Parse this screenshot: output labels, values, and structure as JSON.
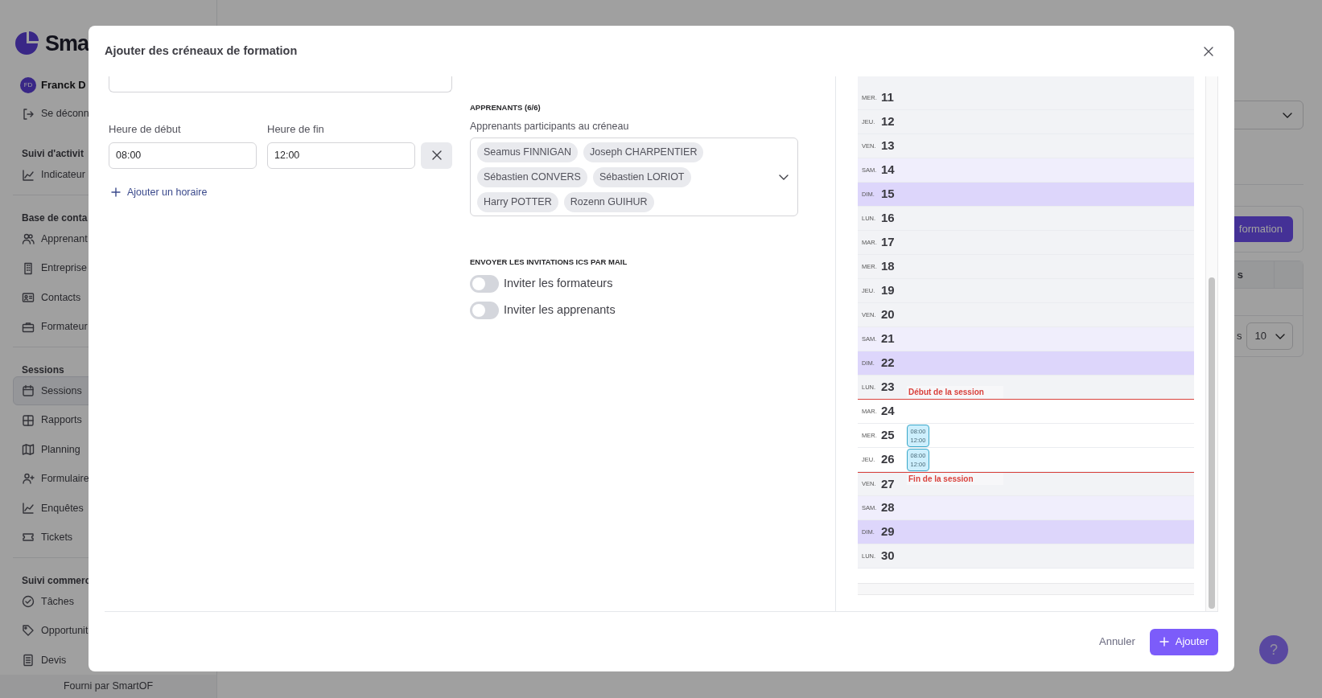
{
  "sidebar": {
    "logo_text": "Sma",
    "user": {
      "initials": "FD",
      "name": "Franck D"
    },
    "logout": "Se déconn",
    "sections": [
      {
        "title": "Suivi d'activit",
        "items": [
          {
            "label": "Indicateur",
            "selected": false
          }
        ]
      },
      {
        "title": "Base de conta",
        "items": [
          {
            "label": "Apprenant",
            "selected": false
          },
          {
            "label": "Entreprise",
            "selected": false
          },
          {
            "label": "Contacts",
            "selected": false
          },
          {
            "label": "Formateur",
            "selected": false
          }
        ]
      },
      {
        "title": "Sessions",
        "items": [
          {
            "label": "Sessions",
            "selected": true
          },
          {
            "label": "Rapports",
            "selected": false
          },
          {
            "label": "Planning",
            "selected": false
          },
          {
            "label": "Formulaire",
            "selected": false
          },
          {
            "label": "Enquêtes",
            "selected": false
          },
          {
            "label": "Tickets",
            "selected": false
          }
        ]
      },
      {
        "title": "Suivi commerc",
        "items": [
          {
            "label": "Tâches",
            "selected": false
          },
          {
            "label": "Opportunit",
            "selected": false
          },
          {
            "label": "Devis",
            "selected": false
          }
        ]
      }
    ],
    "credit": {
      "text": "Fourni par",
      "link": "SmartOF"
    }
  },
  "background": {
    "action_button": "formation",
    "table_header": "s",
    "table_footer": "s",
    "page_size": "10",
    "help_button": "?"
  },
  "modal": {
    "title": "Ajouter des créneaux de formation",
    "schedule": {
      "start_label": "Heure de début",
      "start_value": "08:00",
      "end_label": "Heure de fin",
      "end_value": "12:00",
      "add_link": "Ajouter un horaire"
    },
    "learners": {
      "heading": "APPRENANTS (6/6)",
      "label": "Apprenants participants au créneau",
      "chips": [
        "Seamus FINNIGAN",
        "Joseph CHARPENTIER",
        "Sébastien CONVERS",
        "Sébastien LORIOT",
        "Harry POTTER",
        "Rozenn GUIHUR"
      ]
    },
    "invitations": {
      "heading": "ENVOYER LES INVITATIONS ICS PAR MAIL",
      "toggles": [
        {
          "label": "Inviter les formateurs",
          "on": false
        },
        {
          "label": "Inviter les apprenants",
          "on": false
        }
      ]
    },
    "calendar": {
      "days": [
        {
          "weekday": "MER.",
          "day": "11",
          "kind": "weekday",
          "in_session": false
        },
        {
          "weekday": "JEU.",
          "day": "12",
          "kind": "weekday",
          "in_session": false
        },
        {
          "weekday": "VEN.",
          "day": "13",
          "kind": "weekday",
          "in_session": false
        },
        {
          "weekday": "SAM.",
          "day": "14",
          "kind": "saturday",
          "in_session": false
        },
        {
          "weekday": "DIM.",
          "day": "15",
          "kind": "sunday",
          "in_session": false
        },
        {
          "weekday": "LUN.",
          "day": "16",
          "kind": "weekday",
          "in_session": false
        },
        {
          "weekday": "MAR.",
          "day": "17",
          "kind": "weekday",
          "in_session": false
        },
        {
          "weekday": "MER.",
          "day": "18",
          "kind": "weekday",
          "in_session": false
        },
        {
          "weekday": "JEU.",
          "day": "19",
          "kind": "weekday",
          "in_session": false
        },
        {
          "weekday": "VEN.",
          "day": "20",
          "kind": "weekday",
          "in_session": false
        },
        {
          "weekday": "SAM.",
          "day": "21",
          "kind": "saturday",
          "in_session": false
        },
        {
          "weekday": "DIM.",
          "day": "22",
          "kind": "sunday",
          "in_session": false
        },
        {
          "weekday": "LUN.",
          "day": "23",
          "kind": "weekday",
          "in_session": false,
          "marker": {
            "kind": "start",
            "label": "Début de la session"
          }
        },
        {
          "weekday": "MAR.",
          "day": "24",
          "kind": "weekday",
          "in_session": true
        },
        {
          "weekday": "MER.",
          "day": "25",
          "kind": "weekday",
          "in_session": true,
          "events": [
            {
              "start": "08:00",
              "end": "12:00"
            }
          ]
        },
        {
          "weekday": "JEU.",
          "day": "26",
          "kind": "weekday",
          "in_session": true,
          "events": [
            {
              "start": "08:00",
              "end": "12:00"
            }
          ]
        },
        {
          "weekday": "VEN.",
          "day": "27",
          "kind": "weekday",
          "in_session": false,
          "marker": {
            "kind": "end",
            "label": "Fin de la session"
          }
        },
        {
          "weekday": "SAM.",
          "day": "28",
          "kind": "saturday",
          "in_session": false
        },
        {
          "weekday": "DIM.",
          "day": "29",
          "kind": "sunday",
          "in_session": false
        },
        {
          "weekday": "LUN.",
          "day": "30",
          "kind": "weekday",
          "in_session": false
        }
      ]
    },
    "footer": {
      "cancel": "Annuler",
      "submit": "Ajouter"
    }
  }
}
